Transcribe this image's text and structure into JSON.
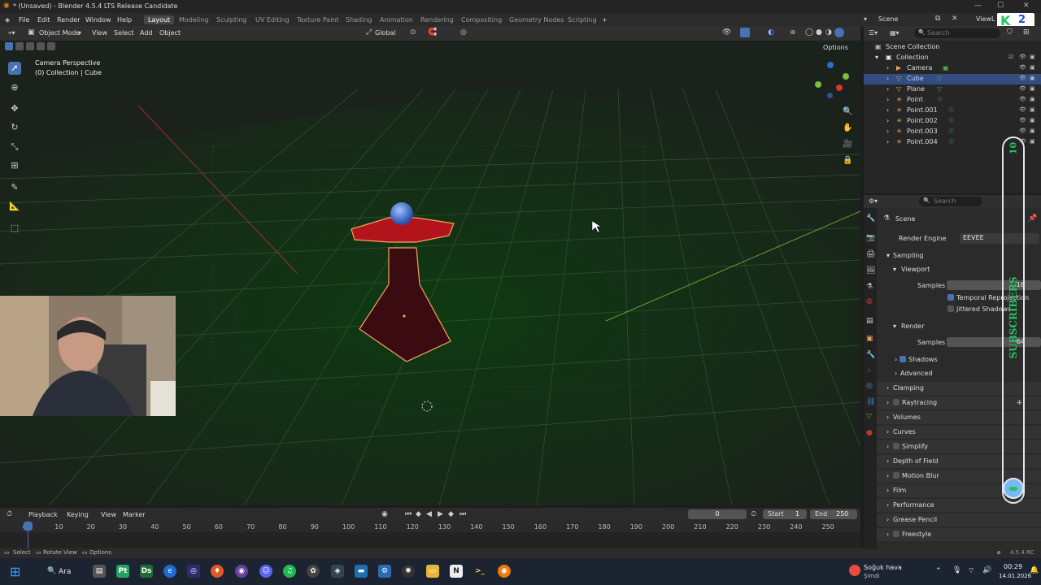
{
  "window": {
    "title": "* (Unsaved) - Blender 4.5.4 LTS Release Candidate"
  },
  "menu": [
    "File",
    "Edit",
    "Render",
    "Window",
    "Help"
  ],
  "workspaces": [
    "Layout",
    "Modeling",
    "Sculpting",
    "UV Editing",
    "Texture Paint",
    "Shading",
    "Animation",
    "Rendering",
    "Compositing",
    "Geometry Nodes",
    "Scripting"
  ],
  "viewport_header": {
    "mode": "Object Mode",
    "menus": [
      "View",
      "Select",
      "Add",
      "Object"
    ],
    "transform": "Global",
    "options": "Options"
  },
  "viewport": {
    "overlay_line1": "Camera Perspective",
    "overlay_line2": "(0) Collection | Cube"
  },
  "timeline": {
    "menus": [
      "Playback",
      "Keying",
      "View",
      "Marker"
    ],
    "current_frame": "0",
    "start_label": "Start",
    "start": "1",
    "end_label": "End",
    "end": "250",
    "ticks": [
      "0",
      "10",
      "20",
      "30",
      "40",
      "50",
      "60",
      "70",
      "80",
      "90",
      "100",
      "110",
      "120",
      "130",
      "140",
      "150",
      "160",
      "170",
      "180",
      "190",
      "200",
      "210",
      "220",
      "230",
      "240",
      "250"
    ]
  },
  "statusbar": {
    "select": "Select",
    "rotate": "Rotate View",
    "options": "Options",
    "version": "4.5.4 RC"
  },
  "topright": {
    "scene": "Scene",
    "viewlayer": "ViewL"
  },
  "outliner": {
    "search_placeholder": "Search",
    "scene_collection": "Scene Collection",
    "collection": "Collection",
    "items": [
      "Camera",
      "Cube",
      "Plane",
      "Point",
      "Point.001",
      "Point.002",
      "Point.003",
      "Point.004"
    ]
  },
  "properties": {
    "search_placeholder": "Search",
    "scene": "Scene",
    "render_engine_label": "Render Engine",
    "render_engine": "EEVEE",
    "sampling": "Sampling",
    "viewport": "Viewport",
    "samples_label": "Samples",
    "viewport_samples": "16",
    "temporal": "Temporal Reprojection",
    "jittered": "Jittered Shadows",
    "render": "Render",
    "render_samples": "64",
    "shadows": "Shadows",
    "advanced": "Advanced",
    "panels": [
      "Clamping",
      "Raytracing",
      "Volumes",
      "Curves",
      "Simplify",
      "Depth of Field",
      "Motion Blur",
      "Film",
      "Performance",
      "Grease Pencil",
      "Freestyle"
    ]
  },
  "overlay_banner": {
    "count": "10",
    "text": "SUBSCRIBERS"
  },
  "taskbar": {
    "search": "Ara",
    "weather": "Soğuk hava",
    "weather_sub": "Şimdi",
    "time": "00:29",
    "date": "14.01.2026"
  },
  "colors": {
    "accent": "#4772b3",
    "selection_outline": "#f4a460",
    "grid": "#3c6b3a",
    "banner_text": "#22c55e"
  }
}
